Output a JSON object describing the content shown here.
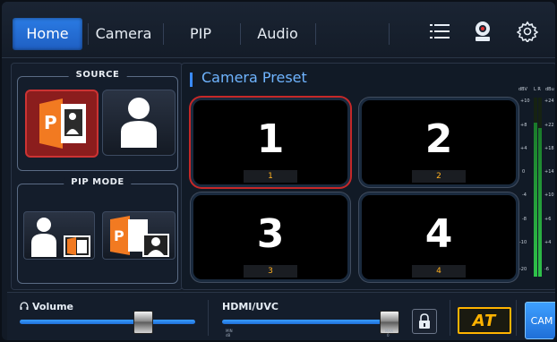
{
  "tabs": [
    {
      "label": "Home",
      "active": true
    },
    {
      "label": "Camera",
      "active": false
    },
    {
      "label": "PIP",
      "active": false
    },
    {
      "label": "Audio",
      "active": false
    }
  ],
  "header_icons": [
    "list-icon",
    "camera-device-icon",
    "settings-gear-icon"
  ],
  "source": {
    "title": "SOURCE",
    "options": [
      {
        "name": "presentation-source",
        "active": true
      },
      {
        "name": "camera-person-source",
        "active": false
      }
    ]
  },
  "pip_mode": {
    "title": "PIP MODE",
    "options": [
      "person-main-pip",
      "presentation-main-pip"
    ]
  },
  "camera_preset": {
    "title": "Camera Preset",
    "presets": [
      {
        "number": "1",
        "label": "1",
        "selected": true
      },
      {
        "number": "2",
        "label": "2",
        "selected": false
      },
      {
        "number": "3",
        "label": "3",
        "selected": false
      },
      {
        "number": "4",
        "label": "4",
        "selected": false
      }
    ]
  },
  "vu_meter": {
    "header_left": "dBV",
    "channels": "L R",
    "header_right": "dBu",
    "left_scale": [
      "+10",
      "+8",
      "+4",
      "0",
      "-4",
      "-8",
      "-10",
      "-20"
    ],
    "right_scale": [
      "+24",
      "+22",
      "+18",
      "+14",
      "+10",
      "+6",
      "+4",
      "-6"
    ],
    "level_left": 0.86,
    "level_right": 0.83
  },
  "volume": {
    "label": "Volume",
    "value": 0.7
  },
  "hdmi_uvc": {
    "label": "HDMI/UVC",
    "value": 0.94,
    "min_label": "MIN",
    "min_value": "dB",
    "max_label": "MAX",
    "max_value": "0"
  },
  "buttons": {
    "lock_icon": "lock-icon",
    "auto_tracking": "AT",
    "cam": "CAM"
  },
  "colors": {
    "accent": "#2a7be4",
    "selected_border": "#c62828",
    "preset_label": "#ffb020",
    "at_border": "#ffb300"
  }
}
